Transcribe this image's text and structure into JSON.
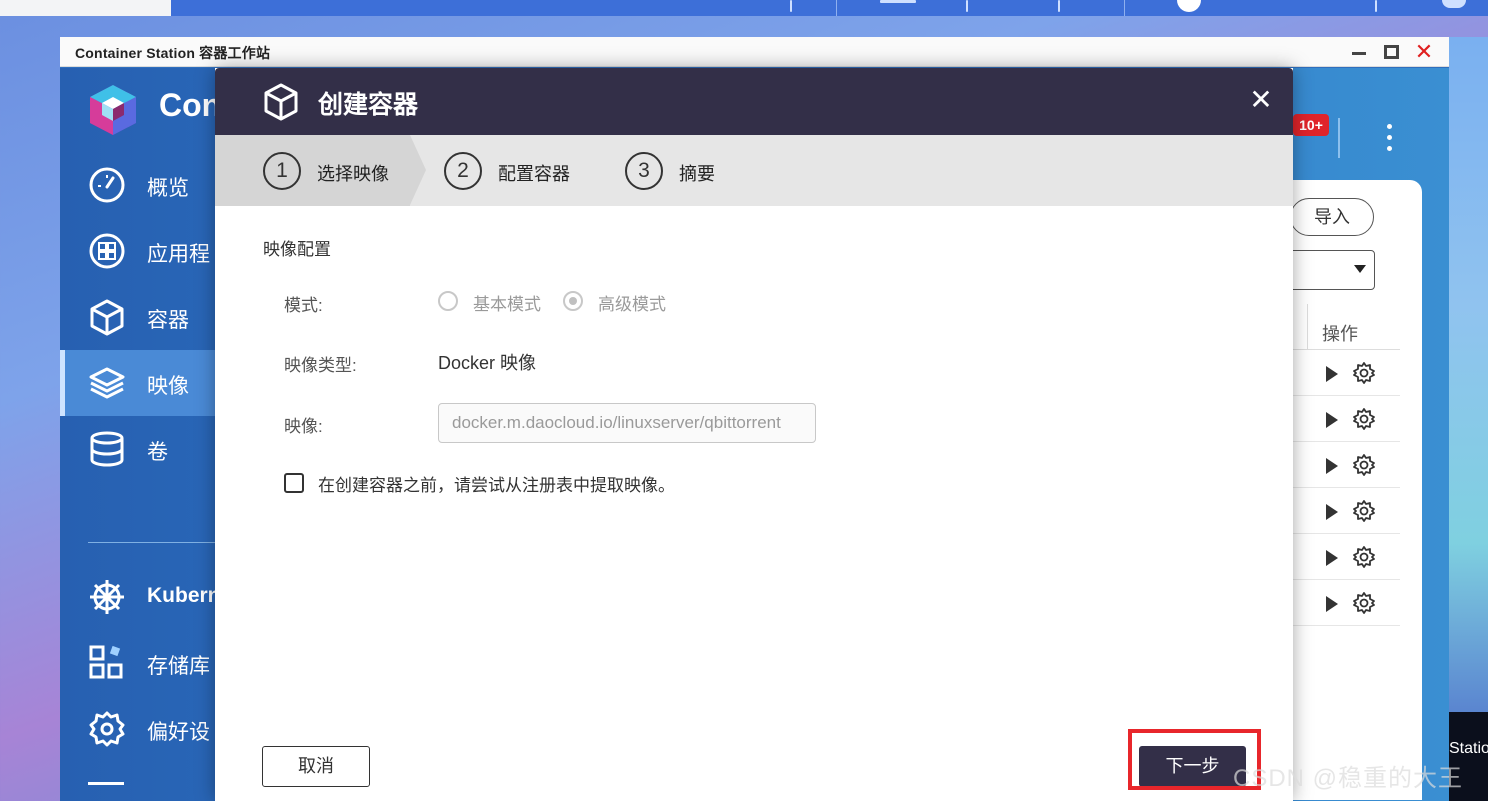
{
  "window": {
    "title": "Container Station 容器工作站"
  },
  "app": {
    "name": "Con",
    "notification_badge": "10+"
  },
  "sidebar": {
    "items": [
      {
        "label": "概览",
        "icon": "gauge-icon"
      },
      {
        "label": "应用程",
        "icon": "apps-grid-icon"
      },
      {
        "label": "容器",
        "icon": "cube-icon"
      },
      {
        "label": "映像",
        "icon": "layers-icon",
        "active": true
      },
      {
        "label": "卷",
        "icon": "database-icon"
      },
      {
        "label": "Kubern",
        "icon": "helm-wheel-icon"
      },
      {
        "label": "存储库",
        "icon": "repository-icon"
      },
      {
        "label": "偏好设",
        "icon": "gear-icon"
      }
    ]
  },
  "background_panel": {
    "import_label": "导入",
    "ops_column": "操作",
    "row_count": 6
  },
  "corner_text": "Statio",
  "modal": {
    "title": "创建容器",
    "steps": [
      {
        "num": "1",
        "label": "选择映像",
        "active": true
      },
      {
        "num": "2",
        "label": "配置容器"
      },
      {
        "num": "3",
        "label": "摘要"
      }
    ],
    "section_title": "映像配置",
    "mode_label": "模式:",
    "mode_options": [
      {
        "label": "基本模式",
        "checked": false
      },
      {
        "label": "高级模式",
        "checked": true
      }
    ],
    "image_type_label": "映像类型:",
    "image_type_value": "Docker 映像",
    "image_label": "映像:",
    "image_value": "docker.m.daocloud.io/linuxserver/qbittorrent",
    "pull_checkbox_label": "在创建容器之前，请尝试从注册表中提取映像。",
    "pull_checkbox_checked": false,
    "cancel_label": "取消",
    "next_label": "下一步"
  },
  "watermark": "CSDN @稳重的大王",
  "colors": {
    "modal_header": "#332f48",
    "app_blue": "#2f6fbe",
    "highlight": "#e8262b"
  }
}
